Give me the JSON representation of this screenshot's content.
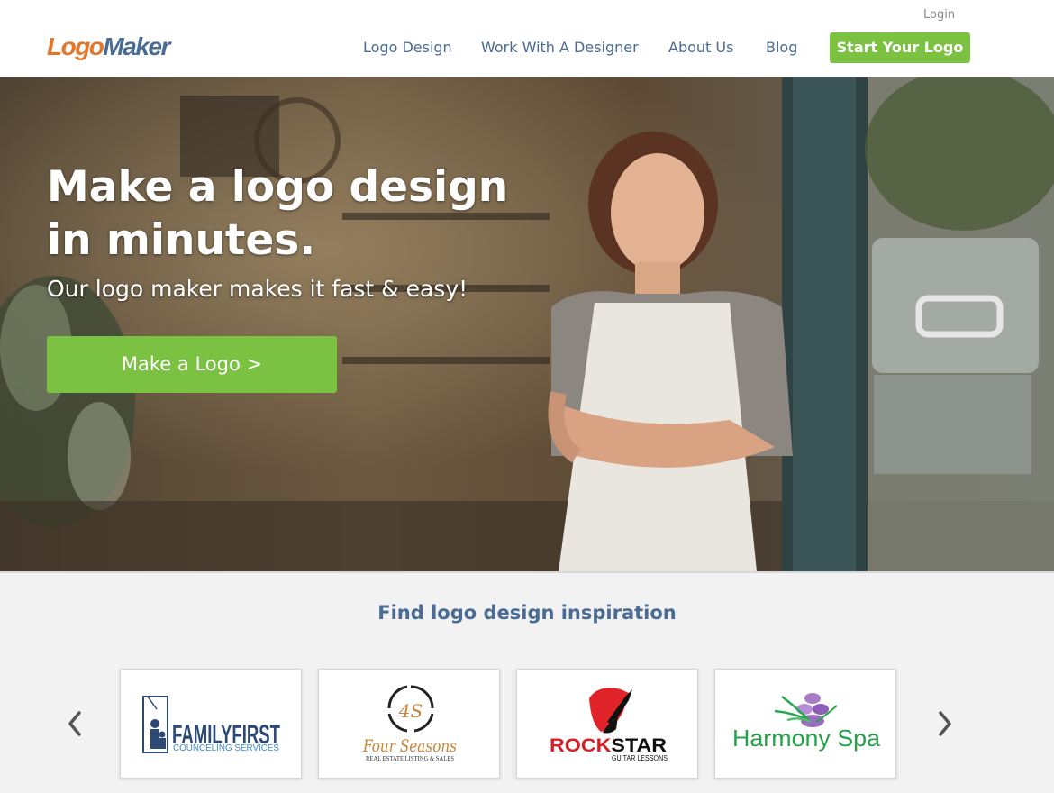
{
  "brand": {
    "logo_part1": "Logo",
    "logo_part2": "Maker"
  },
  "header": {
    "login": "Login",
    "nav": [
      "Logo Design",
      "Work With A Designer",
      "About Us",
      "Blog"
    ],
    "cta": "Start Your Logo"
  },
  "hero": {
    "title": "Make a logo design in minutes.",
    "subtitle": "Our logo maker makes it fast & easy!",
    "cta": "Make a Logo >"
  },
  "inspiration": {
    "title": "Find logo design inspiration",
    "cards": [
      {
        "name": "FAMILYFIRST",
        "tagline": "COUNCELING SERVICES"
      },
      {
        "name": "Four Seasons",
        "tagline": "REAL ESTATE LISTING & SALES"
      },
      {
        "name_part1": "ROCK",
        "name_part2": "STAR",
        "tagline": "GUITAR LESSONS"
      },
      {
        "name": "Harmony Spa"
      }
    ]
  },
  "colors": {
    "accent_green": "#7cc242",
    "nav_blue": "#4a6b94",
    "logo_orange": "#e0772c"
  },
  "icons": {
    "prev": "chevron-left-icon",
    "next": "chevron-right-icon"
  }
}
